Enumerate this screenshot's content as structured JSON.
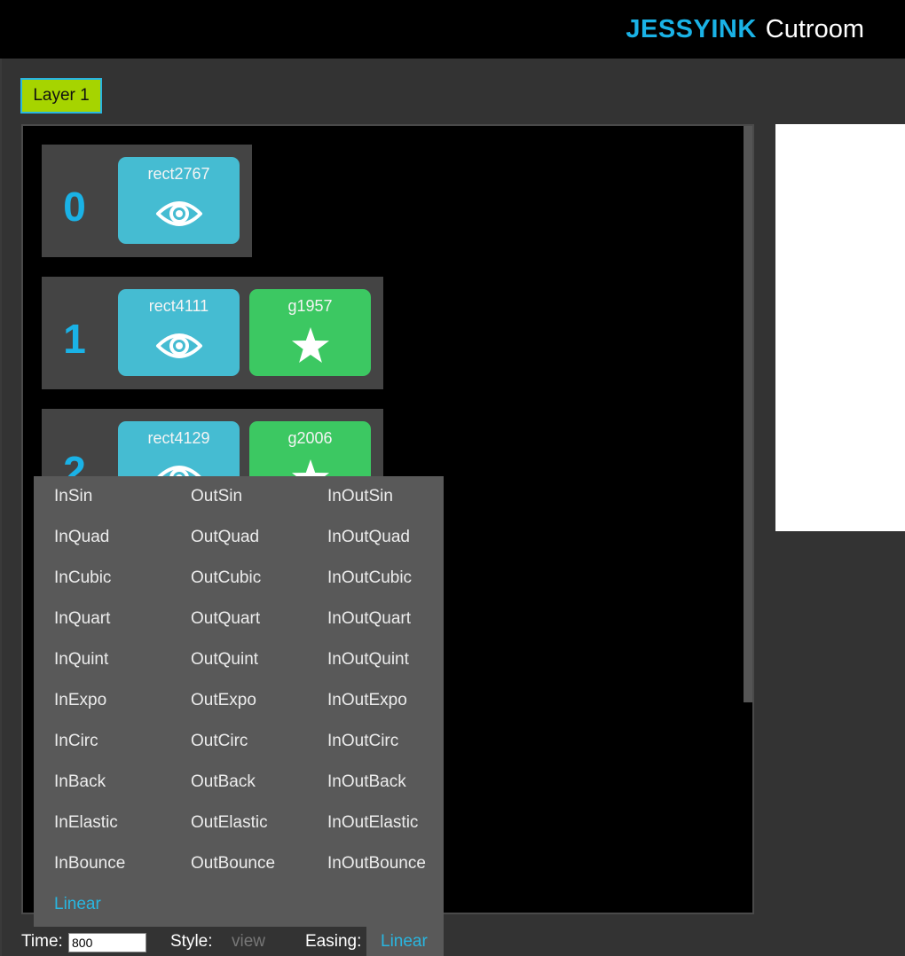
{
  "header": {
    "brand_primary": "JESSYINK",
    "brand_secondary": "Cutroom"
  },
  "layer_tab": {
    "label": "Layer 1"
  },
  "frames": [
    {
      "number": "0",
      "elements": [
        {
          "label": "rect2767",
          "icon": "eye-icon",
          "color": "#45bcd2"
        }
      ]
    },
    {
      "number": "1",
      "elements": [
        {
          "label": "rect4111",
          "icon": "eye-icon",
          "color": "#45bcd2"
        },
        {
          "label": "g1957",
          "icon": "star-icon",
          "color": "#3cc862"
        }
      ]
    },
    {
      "number": "2",
      "elements": [
        {
          "label": "rect4129",
          "icon": "eye-icon",
          "color": "#45bcd2"
        },
        {
          "label": "g2006",
          "icon": "star-icon",
          "color": "#3cc862"
        }
      ]
    }
  ],
  "easing_menu": {
    "columns": [
      [
        "InSin",
        "InQuad",
        "InCubic",
        "InQuart",
        "InQuint",
        "InExpo",
        "InCirc",
        "InBack",
        "InElastic",
        "InBounce",
        "Linear"
      ],
      [
        "OutSin",
        "OutQuad",
        "OutCubic",
        "OutQuart",
        "OutQuint",
        "OutExpo",
        "OutCirc",
        "OutBack",
        "OutElastic",
        "OutBounce"
      ],
      [
        "InOutSin",
        "InOutQuad",
        "InOutCubic",
        "InOutQuart",
        "InOutQuint",
        "InOutExpo",
        "InOutCirc",
        "InOutBack",
        "InOutElastic",
        "InOutBounce"
      ]
    ],
    "selected": "Linear"
  },
  "controls": {
    "time_label": "Time:",
    "time_value": "800",
    "style_label": "Style:",
    "style_value": "view",
    "easing_label": "Easing:",
    "easing_value": "Linear"
  },
  "colors": {
    "accent": "#1ab2e6",
    "layer_tab": "#a6d400",
    "view_element": "#45bcd2",
    "star_element": "#3cc862"
  }
}
